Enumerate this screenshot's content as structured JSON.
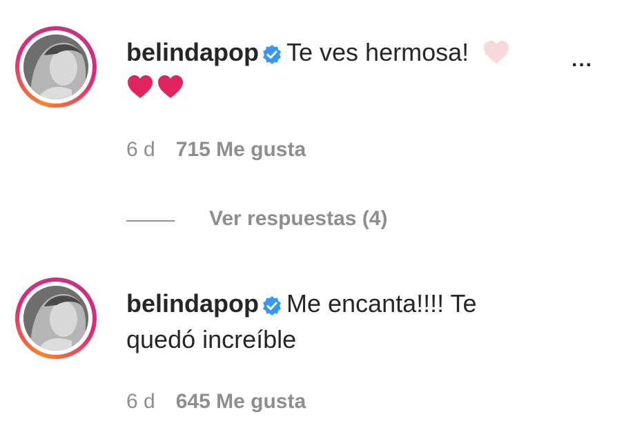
{
  "comments": [
    {
      "username": "belindapop",
      "text": "Te ves hermosa!",
      "emoji_line": "",
      "time": "6 d",
      "likes": "715 Me gusta",
      "more": "..."
    },
    {
      "username": "belindapop",
      "text": "Me encanta!!!! Te",
      "text_line2": "quedó increíble",
      "time": "6 d",
      "likes": "645 Me gusta"
    }
  ],
  "replies": {
    "label": "Ver respuestas (4)"
  },
  "colors": {
    "text": "#262626",
    "muted": "#8e8e8e",
    "verified": "#3897f0",
    "heart_red": "#e0245e",
    "heart_pale": "#f7d9dc"
  },
  "icons": [
    "verified-badge-icon",
    "pale-heart-icon",
    "red-heart-icon"
  ]
}
